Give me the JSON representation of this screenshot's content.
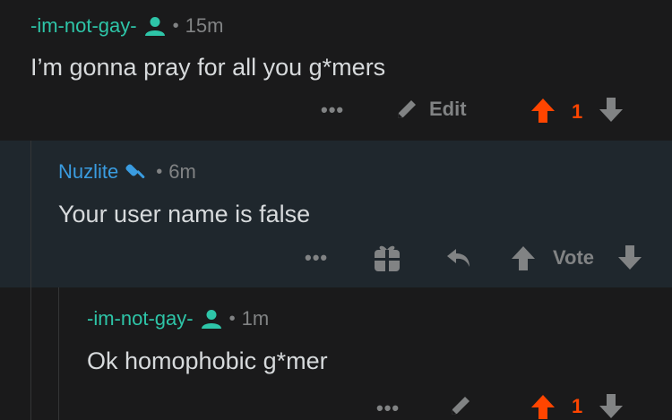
{
  "comments": [
    {
      "author": "-im-not-gay-",
      "time": "15m",
      "body": "I’m gonna pray for all you g*mers",
      "edit_label": "Edit",
      "vote_count": "1",
      "author_color": "#2ec5a8"
    },
    {
      "author": "Nuzlite",
      "time": "6m",
      "body": "Your user name is false",
      "vote_label": "Vote",
      "author_color": "#3a9ce0"
    },
    {
      "author": "-im-not-gay-",
      "time": "1m",
      "body": "Ok homophobic g*mer",
      "vote_count": "1",
      "author_color": "#2ec5a8"
    }
  ],
  "separator": "•",
  "more_label": "•••",
  "colors": {
    "background": "#1a1a1b",
    "highlight_background": "#1f272d",
    "upvoted": "#ff4500",
    "muted": "#818384",
    "mod_author": "#2ec5a8",
    "reply_author": "#3a9ce0"
  },
  "icons": {
    "user": "user-icon",
    "mod": "broom-icon",
    "edit": "pencil-icon",
    "upvote": "arrow-up-icon",
    "downvote": "arrow-down-icon",
    "award": "gift-icon",
    "reply": "reply-icon",
    "more": "more-icon"
  }
}
